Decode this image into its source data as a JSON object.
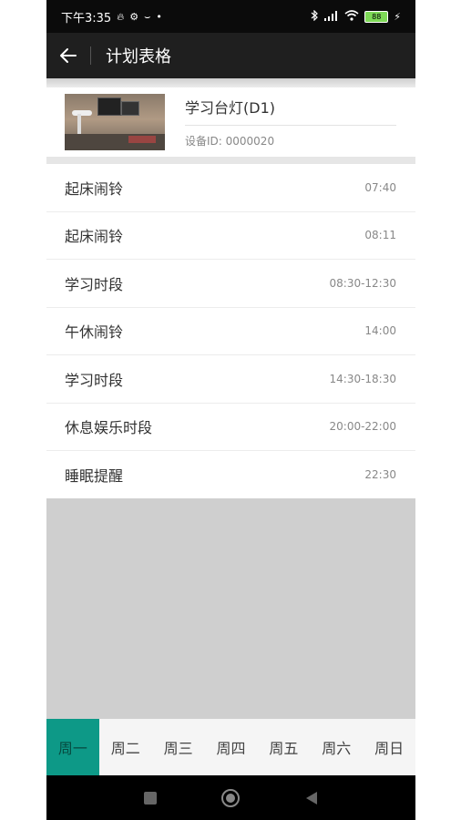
{
  "status_bar": {
    "time": "下午3:35",
    "battery": "88"
  },
  "app_bar": {
    "title": "计划表格"
  },
  "device": {
    "name": "学习台灯(D1)",
    "id_text": "设备ID: 0000020"
  },
  "schedule": [
    {
      "label": "起床闹铃",
      "time": "07:40"
    },
    {
      "label": "起床闹铃",
      "time": "08:11"
    },
    {
      "label": "学习时段",
      "time": "08:30-12:30"
    },
    {
      "label": "午休闹铃",
      "time": "14:00"
    },
    {
      "label": "学习时段",
      "time": "14:30-18:30"
    },
    {
      "label": "休息娱乐时段",
      "time": "20:00-22:00"
    },
    {
      "label": "睡眠提醒",
      "time": "22:30"
    }
  ],
  "week_tabs": [
    {
      "label": "周一",
      "active": true
    },
    {
      "label": "周二",
      "active": false
    },
    {
      "label": "周三",
      "active": false
    },
    {
      "label": "周四",
      "active": false
    },
    {
      "label": "周五",
      "active": false
    },
    {
      "label": "周六",
      "active": false
    },
    {
      "label": "周日",
      "active": false
    }
  ],
  "colors": {
    "accent": "#0d9987",
    "app_bar": "#1f1f1f",
    "status_bar": "#0b0b0b"
  }
}
